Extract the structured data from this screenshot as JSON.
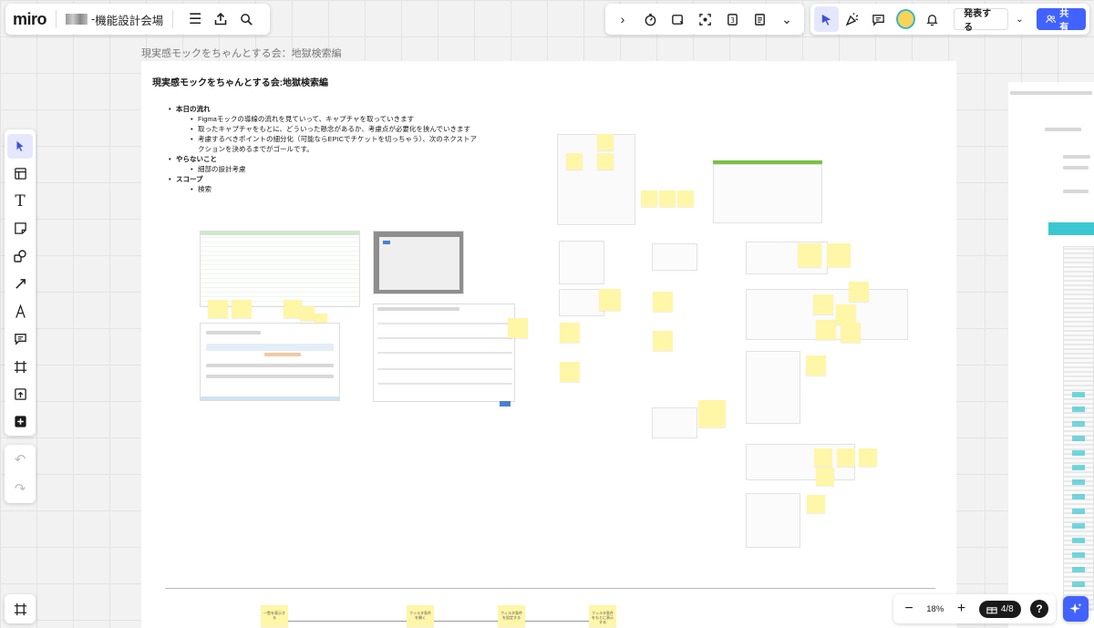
{
  "app": {
    "logo": "miro",
    "board_name": "機能設計会場",
    "breadcrumb_separator": "-"
  },
  "toolbar_right": {
    "expand_icon": "chevron-right-icon",
    "items": [
      "timer-icon",
      "card-icon",
      "capture-icon",
      "number-3-icon",
      "notes-icon",
      "more-chevron-icon"
    ]
  },
  "collab": {
    "present_label": "発表する",
    "share_label": "共有"
  },
  "left_tools": [
    "select-icon",
    "templates-icon",
    "text-icon",
    "sticky-note-icon",
    "shapes-icon",
    "connector-icon",
    "pen-icon",
    "comment-icon",
    "frame-icon",
    "upload-icon",
    "add-icon"
  ],
  "frame": {
    "label": "現実感モックをちゃんとする会：地獄検索編",
    "title": "現実感モックをちゃんとする会:地獄検索編",
    "sections": [
      {
        "heading": "本日の流れ",
        "items": [
          "Figmaモックの導線の流れを見ていって、キャプチャを取っていきます",
          "取ったキャプチャをもとに、どういった懸念があるか、考慮点が必要化を挟んでいきます",
          "考慮するべきポイントの細分化（可能ならEPICでチケットを切っちゃう）、次のネクストアクションを決めるまでがゴールです。"
        ]
      },
      {
        "heading": "やらないこと",
        "items": [
          "細部の設計考慮"
        ]
      },
      {
        "heading": "スコープ",
        "items": [
          "検索"
        ]
      }
    ],
    "flow_stickies": [
      "一覧を表示する",
      "フィルタ条件を開く",
      "フィルタ条件を設定する",
      "フィルタ条件をもとに表示する"
    ]
  },
  "zoom": {
    "value": "18%",
    "page_indicator": "4/8",
    "help": "?"
  },
  "colors": {
    "accent": "#4262ff",
    "sticky": "#fff6a8",
    "highlight_green": "#7cc142",
    "highlight_teal": "#3bc7d0"
  }
}
